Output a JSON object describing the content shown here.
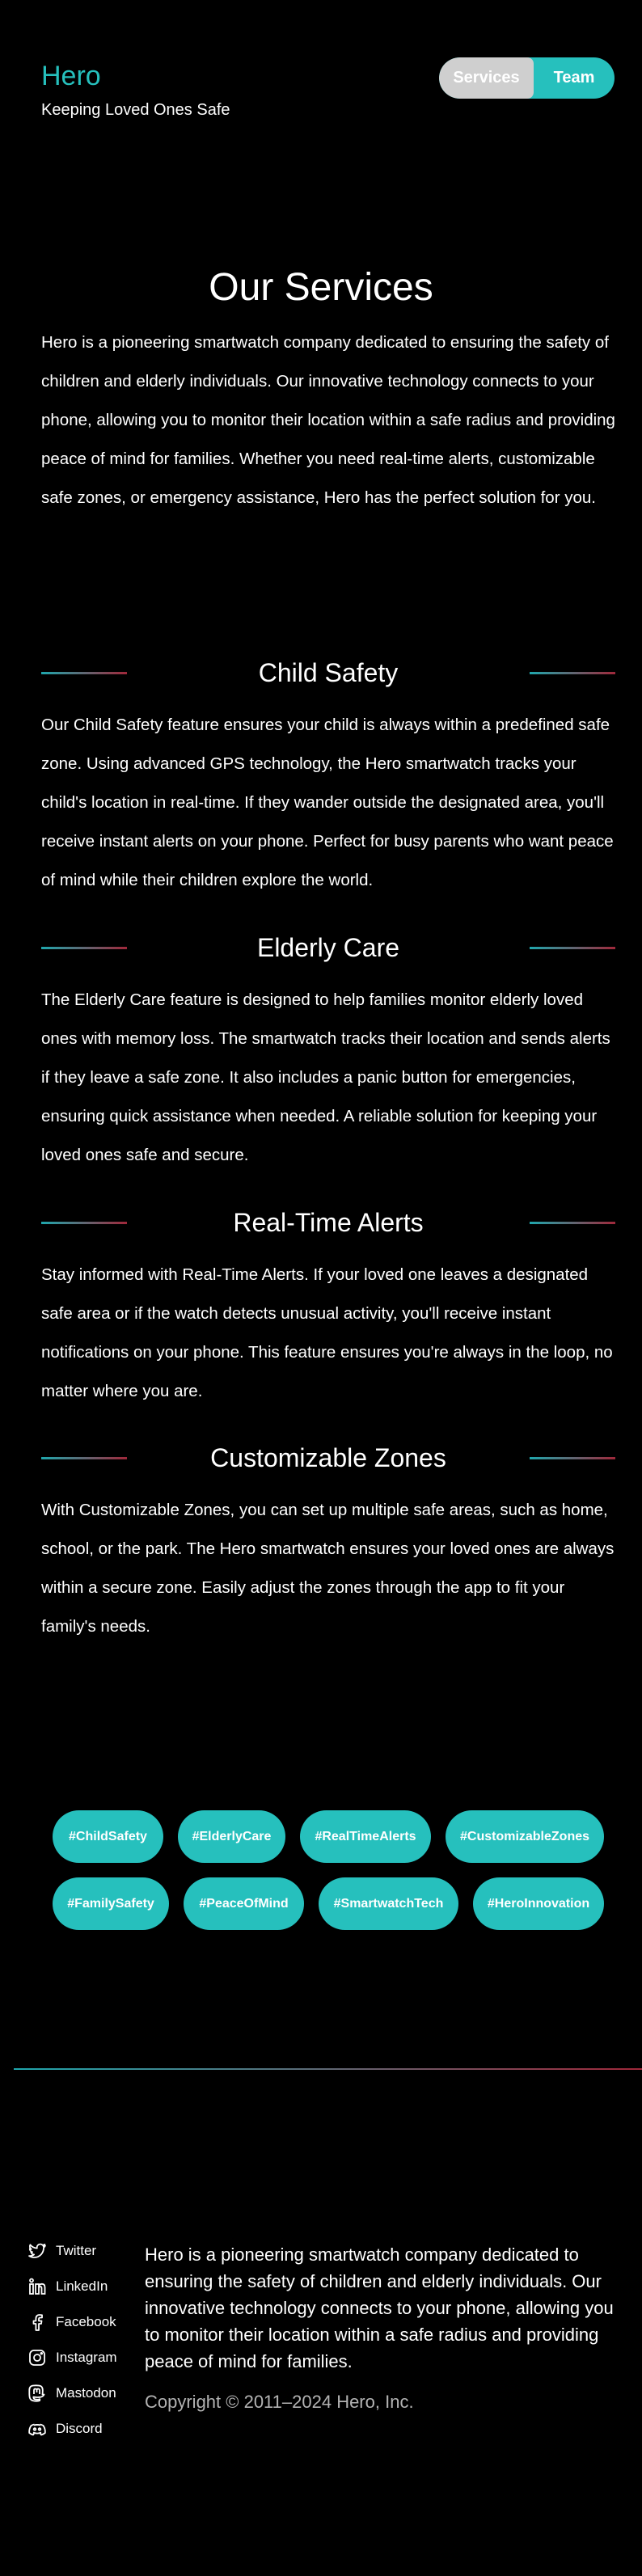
{
  "header": {
    "brand_name": "Hero",
    "tagline": "Keeping Loved Ones Safe",
    "nav": {
      "services_label": "Services",
      "team_label": "Team"
    }
  },
  "intro": {
    "title": "Our Services",
    "text": "Hero is a pioneering smartwatch company dedicated to ensuring the safety of children and elderly individuals. Our innovative technology connects to your phone, allowing you to monitor their location within a safe radius and providing peace of mind for families. Whether you need real-time alerts, customizable safe zones, or emergency assistance, Hero has the perfect solution for you."
  },
  "services": [
    {
      "title": "Child Safety",
      "text": "Our Child Safety feature ensures your child is always within a predefined safe zone. Using advanced GPS technology, the Hero smartwatch tracks your child's location in real-time. If they wander outside the designated area, you'll receive instant alerts on your phone. Perfect for busy parents who want peace of mind while their children explore the world."
    },
    {
      "title": "Elderly Care",
      "text": "The Elderly Care feature is designed to help families monitor elderly loved ones with memory loss. The smartwatch tracks their location and sends alerts if they leave a safe zone. It also includes a panic button for emergencies, ensuring quick assistance when needed. A reliable solution for keeping your loved ones safe and secure."
    },
    {
      "title": "Real-Time Alerts",
      "text": "Stay informed with Real-Time Alerts. If your loved one leaves a designated safe area or if the watch detects unusual activity, you'll receive instant notifications on your phone. This feature ensures you're always in the loop, no matter where you are."
    },
    {
      "title": "Customizable Zones",
      "text": "With Customizable Zones, you can set up multiple safe areas, such as home, school, or the park. The Hero smartwatch ensures your loved ones are always within a secure zone. Easily adjust the zones through the app to fit your family's needs."
    }
  ],
  "tags": {
    "row1": [
      "#ChildSafety",
      "#ElderlyCare",
      "#RealTimeAlerts",
      "#CustomizableZones"
    ],
    "row2": [
      "#FamilySafety",
      "#PeaceOfMind",
      "#SmartwatchTech",
      "#HeroInnovation"
    ]
  },
  "footer": {
    "social": [
      {
        "label": "Twitter",
        "icon": "twitter-icon"
      },
      {
        "label": "LinkedIn",
        "icon": "linkedin-icon"
      },
      {
        "label": "Facebook",
        "icon": "facebook-icon"
      },
      {
        "label": "Instagram",
        "icon": "instagram-icon"
      },
      {
        "label": "Mastodon",
        "icon": "mastodon-icon"
      },
      {
        "label": "Discord",
        "icon": "discord-icon"
      }
    ],
    "about": "Hero is a pioneering smartwatch company dedicated to ensuring the safety of children and elderly individuals. Our innovative technology connects to your phone, allowing you to monitor their location within a safe radius and providing peace of mind for families.",
    "copyright": "Copyright © 2011–2024 Hero, Inc."
  },
  "colors": {
    "accent": "#26c0bd",
    "background": "#000000",
    "line_start": "#1fa7ad",
    "line_end": "#a0283a"
  }
}
